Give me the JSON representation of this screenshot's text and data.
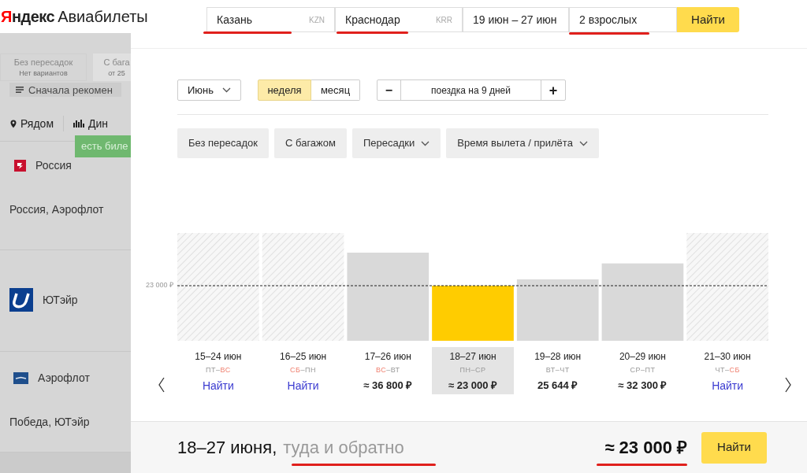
{
  "header": {
    "logo": {
      "brand": "Яндекс",
      "product": "Авиабилеты"
    },
    "search": {
      "from": {
        "value": "Казань",
        "code": "KZN"
      },
      "to": {
        "value": "Краснодар",
        "code": "KRR"
      },
      "dates": "19 июн – 27 июн",
      "passengers": "2 взрослых",
      "button": "Найти"
    }
  },
  "results_panel": {
    "filters": [
      {
        "label": "Без пересадок",
        "note": "Нет вариантов"
      },
      {
        "label": "С бага",
        "note": "от 25"
      }
    ],
    "sort": "Сначала рекомен",
    "views": [
      {
        "label": "Рядом",
        "kind": "nearby"
      },
      {
        "label": "Дин",
        "kind": "dynamics"
      }
    ],
    "tooltip": "есть биле",
    "airlines": [
      {
        "name": "Россия",
        "kind": "rossiya",
        "subtitle": "Россия, Аэрофлот"
      },
      {
        "name": "ЮТэйр",
        "kind": "utair"
      },
      {
        "name": "Аэрофлот",
        "kind": "aeroflot",
        "subtitle": "Победа, ЮТэйр"
      }
    ]
  },
  "modal": {
    "month": "Июнь",
    "periods": [
      {
        "label": "неделя",
        "selected": true
      },
      {
        "label": "месяц",
        "selected": false
      }
    ],
    "stepper": {
      "minus": "−",
      "label": "поездка на 9 дней",
      "plus": "+"
    },
    "filters": [
      {
        "label": "Без пересадок",
        "dropdown": false
      },
      {
        "label": "С багажом",
        "dropdown": false
      },
      {
        "label": "Пересадки",
        "dropdown": true
      },
      {
        "label": "Время вылета / прилёта",
        "dropdown": true
      }
    ],
    "chart_data": {
      "type": "bar",
      "categories": [
        "15–24 июн",
        "16–25 июн",
        "17–26 июн",
        "18–27 июн",
        "19–28 июн",
        "20–29 июн",
        "21–30 июн"
      ],
      "values": [
        null,
        null,
        36800,
        23000,
        25644,
        32300,
        null
      ],
      "value_labels": [
        null,
        null,
        "≈ 36 800 ₽",
        "≈ 23 000 ₽",
        "25 644 ₽",
        "≈ 32 300 ₽",
        null
      ]
    },
    "price_line": {
      "label": "23 000 ₽"
    },
    "weeks": [
      {
        "days": [
          {
            "text": "ПТ",
            "weekend": false
          },
          {
            "text": "–",
            "weekend": false
          },
          {
            "text": "ВС",
            "weekend": true
          }
        ],
        "action": "Найти",
        "selected": false
      },
      {
        "days": [
          {
            "text": "СБ",
            "weekend": true
          },
          {
            "text": "–",
            "weekend": false
          },
          {
            "text": "ПН",
            "weekend": false
          }
        ],
        "action": "Найти",
        "selected": false
      },
      {
        "days": [
          {
            "text": "ВС",
            "weekend": true
          },
          {
            "text": "–",
            "weekend": false
          },
          {
            "text": "ВТ",
            "weekend": false
          }
        ],
        "selected": false
      },
      {
        "days": [
          {
            "text": "ПН",
            "weekend": false
          },
          {
            "text": "–",
            "weekend": false
          },
          {
            "text": "СР",
            "weekend": false
          }
        ],
        "selected": true
      },
      {
        "days": [
          {
            "text": "ВТ",
            "weekend": false
          },
          {
            "text": "–",
            "weekend": false
          },
          {
            "text": "ЧТ",
            "weekend": false
          }
        ],
        "selected": false
      },
      {
        "days": [
          {
            "text": "СР",
            "weekend": false
          },
          {
            "text": "–",
            "weekend": false
          },
          {
            "text": "ПТ",
            "weekend": false
          }
        ],
        "selected": false
      },
      {
        "days": [
          {
            "text": "ЧТ",
            "weekend": false
          },
          {
            "text": "–",
            "weekend": false
          },
          {
            "text": "СБ",
            "weekend": true
          }
        ],
        "action": "Найти",
        "selected": false
      }
    ],
    "summary": {
      "dates": "18–27 июня,",
      "trip": "туда и обратно",
      "price": "≈ 23 000 ₽",
      "button": "Найти"
    }
  }
}
